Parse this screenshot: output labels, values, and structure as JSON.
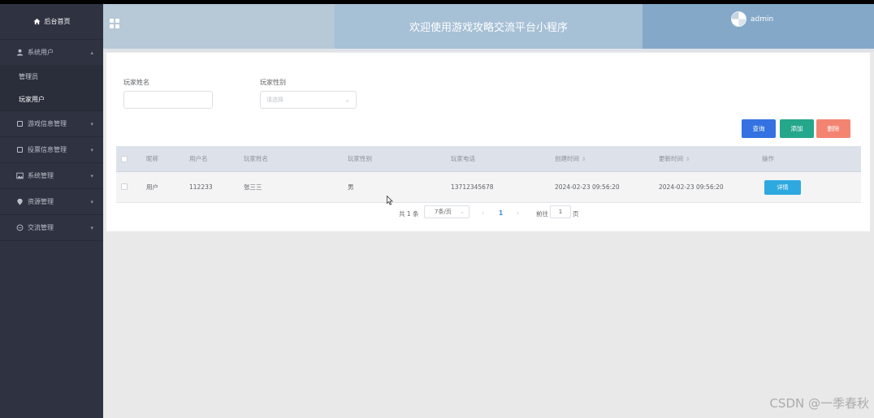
{
  "sidebar": {
    "home_label": "后台首页",
    "groups": [
      {
        "label": "系统用户",
        "expanded": true,
        "chevron": "▴",
        "subitems": [
          {
            "label": "管理员"
          },
          {
            "label": "玩家用户"
          }
        ]
      },
      {
        "label": "游戏信息管理",
        "chevron": "▾"
      },
      {
        "label": "投票信息管理",
        "chevron": "▾"
      },
      {
        "label": "系统管理",
        "chevron": "▾"
      },
      {
        "label": "资源管理",
        "chevron": "▾"
      },
      {
        "label": "交流管理",
        "chevron": "▾"
      }
    ]
  },
  "header": {
    "title": "欢迎使用游戏攻略交流平台小程序",
    "username": "admin"
  },
  "filters": {
    "name_label": "玩家姓名",
    "name_value": "",
    "gender_label": "玩家性别",
    "gender_placeholder": "请选择"
  },
  "actions": {
    "query": "查询",
    "add": "添加",
    "delete": "删除"
  },
  "table": {
    "columns": {
      "nickname": "昵称",
      "username": "用户名",
      "name": "玩家姓名",
      "gender": "玩家性别",
      "phone": "玩家电话",
      "created": "创建时间",
      "updated": "更新时间",
      "ops": "操作"
    },
    "sort_glyph": "⇕",
    "rows": [
      {
        "nickname": "用户",
        "username": "112233",
        "name": "张三三",
        "gender": "男",
        "phone": "13712345678",
        "created": "2024-02-23 09:56:20",
        "updated": "2024-02-23 09:56:20",
        "detail": "详情"
      }
    ]
  },
  "pagination": {
    "total": "共 1 条",
    "page_size": "7条/页",
    "prev": "‹",
    "current": "1",
    "next": "›",
    "goto_label": "前往",
    "goto_value": "1",
    "page_suffix": "页"
  },
  "watermark": "CSDN @一季春秋",
  "colors": {
    "sidebar_bg": "#2f3341",
    "query": "#3372e0",
    "add": "#25a78c",
    "delete": "#f48472",
    "detail": "#2ea9df"
  }
}
